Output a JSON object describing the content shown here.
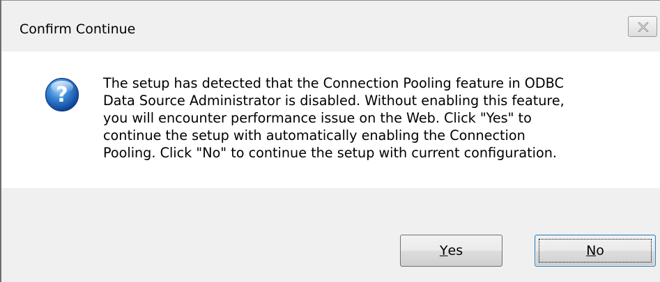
{
  "window": {
    "title": "Confirm Continue",
    "close_icon": "close-icon"
  },
  "message": {
    "icon": "question-icon",
    "text": "The setup has detected that the Connection Pooling feature in ODBC\nData Source Administrator is disabled. Without enabling this feature,\nyou will encounter performance issue on the Web. Click \"Yes\" to\ncontinue the setup with automatically enabling the Connection\nPooling. Click \"No\" to continue the setup with current configuration."
  },
  "buttons": {
    "yes": {
      "mnemonic": "Y",
      "rest": "es"
    },
    "no": {
      "mnemonic": "N",
      "rest": "o"
    }
  },
  "colors": {
    "titlebar": "#f0f0f0",
    "footer": "#f0f0f0",
    "icon_blue": "#2a6fc9"
  }
}
